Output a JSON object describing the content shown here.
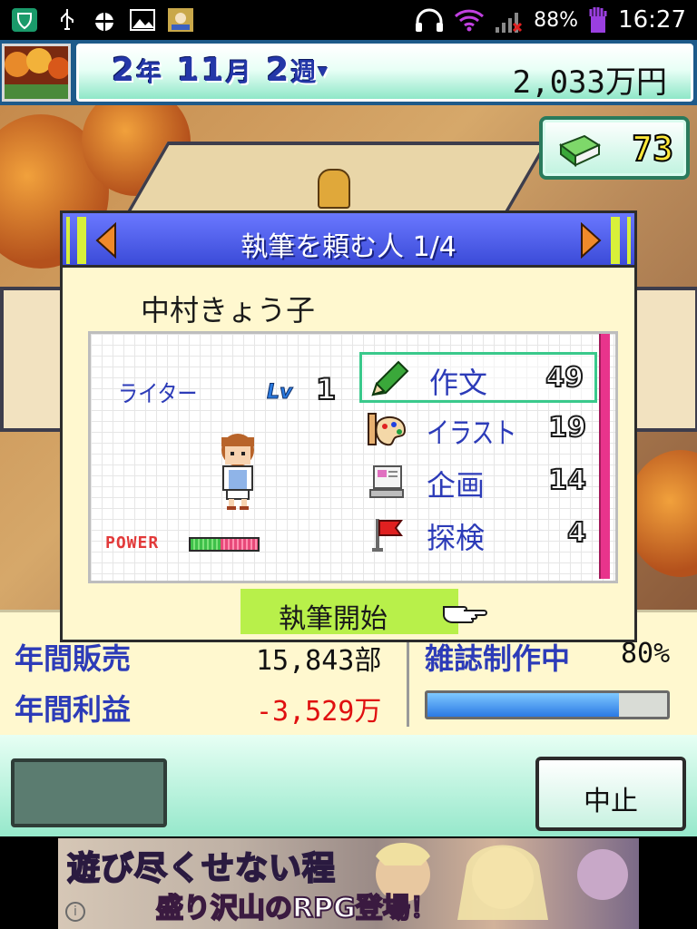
{
  "status_bar": {
    "battery": "88%",
    "time": "16:27"
  },
  "header": {
    "year": "2",
    "year_unit": "年",
    "month": "11",
    "month_unit": "月",
    "week": "2",
    "week_unit": "週",
    "money": "2,033万円"
  },
  "book_counter": {
    "count": "73"
  },
  "dialog": {
    "title": "執筆を頼む人 1/4",
    "person_name": "中村きょう子",
    "job": "ライター",
    "lv_label": "Lv",
    "level": "1",
    "power_label": "POWER",
    "power_level": 0.45,
    "stats": [
      {
        "name": "作文",
        "value": "49",
        "icon": "pencil-icon",
        "selected": true
      },
      {
        "name": "イラスト",
        "value": "19",
        "icon": "palette-icon",
        "selected": false
      },
      {
        "name": "企画",
        "value": "14",
        "icon": "document-icon",
        "selected": false
      },
      {
        "name": "探検",
        "value": "4",
        "icon": "flag-icon",
        "selected": false
      }
    ],
    "start_button": "執筆開始"
  },
  "stats_panel": {
    "annual_sales_label": "年間販売",
    "annual_sales_value": "15,843部",
    "annual_profit_label": "年間利益",
    "annual_profit_value": "-3,529万",
    "magazine_label": "雑誌制作中",
    "magazine_percent": "80%",
    "magazine_progress": 0.8
  },
  "bottom_bar": {
    "stop_button": "中止"
  },
  "ad": {
    "line1": "遊び尽くせない程",
    "line2": "盛り沢山のRPG登場！"
  },
  "colors": {
    "accent_blue": "#3b4bd8",
    "title_text": "#2c3bb8",
    "negative": "#e01010",
    "selected_outline": "#3ac98c",
    "start_button_bg": "#b8f04a"
  }
}
